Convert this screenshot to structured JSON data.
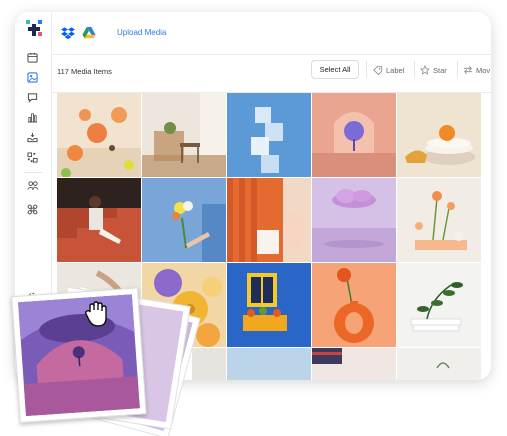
{
  "topbar": {
    "upload_label": "Upload Media",
    "sources": [
      "dropbox-icon",
      "google-drive-icon"
    ]
  },
  "toolbar": {
    "count_label": "117 Media Items",
    "select_all_label": "Select All",
    "label_label": "Label",
    "star_label": "Star",
    "move_label": "Mov"
  },
  "sidebar": {
    "items": [
      "calendar-icon",
      "media-library-icon",
      "chat-icon",
      "analytics-icon",
      "inbox-icon",
      "qr-icon",
      "users-icon",
      "integrations-icon",
      "settings-icon"
    ]
  },
  "media_tiles": [
    "cocktails-on-table",
    "dining-room",
    "ice-cubes",
    "purple-tree-arch",
    "orange-on-plates",
    "girl-on-stairs",
    "flowers-bouquet-sky",
    "candle-orange",
    "pink-cloud",
    "flowers-in-vase",
    "hand-reaching",
    "yellow-flowers",
    "yellow-window-blue-wall",
    "orange-vase-flower",
    "plant-on-books",
    "row4-1",
    "row4-2",
    "row4-3",
    "row4-4",
    "row4-5"
  ],
  "colors": {
    "accent": "#2f7de1",
    "dropbox": "#0061fe"
  }
}
